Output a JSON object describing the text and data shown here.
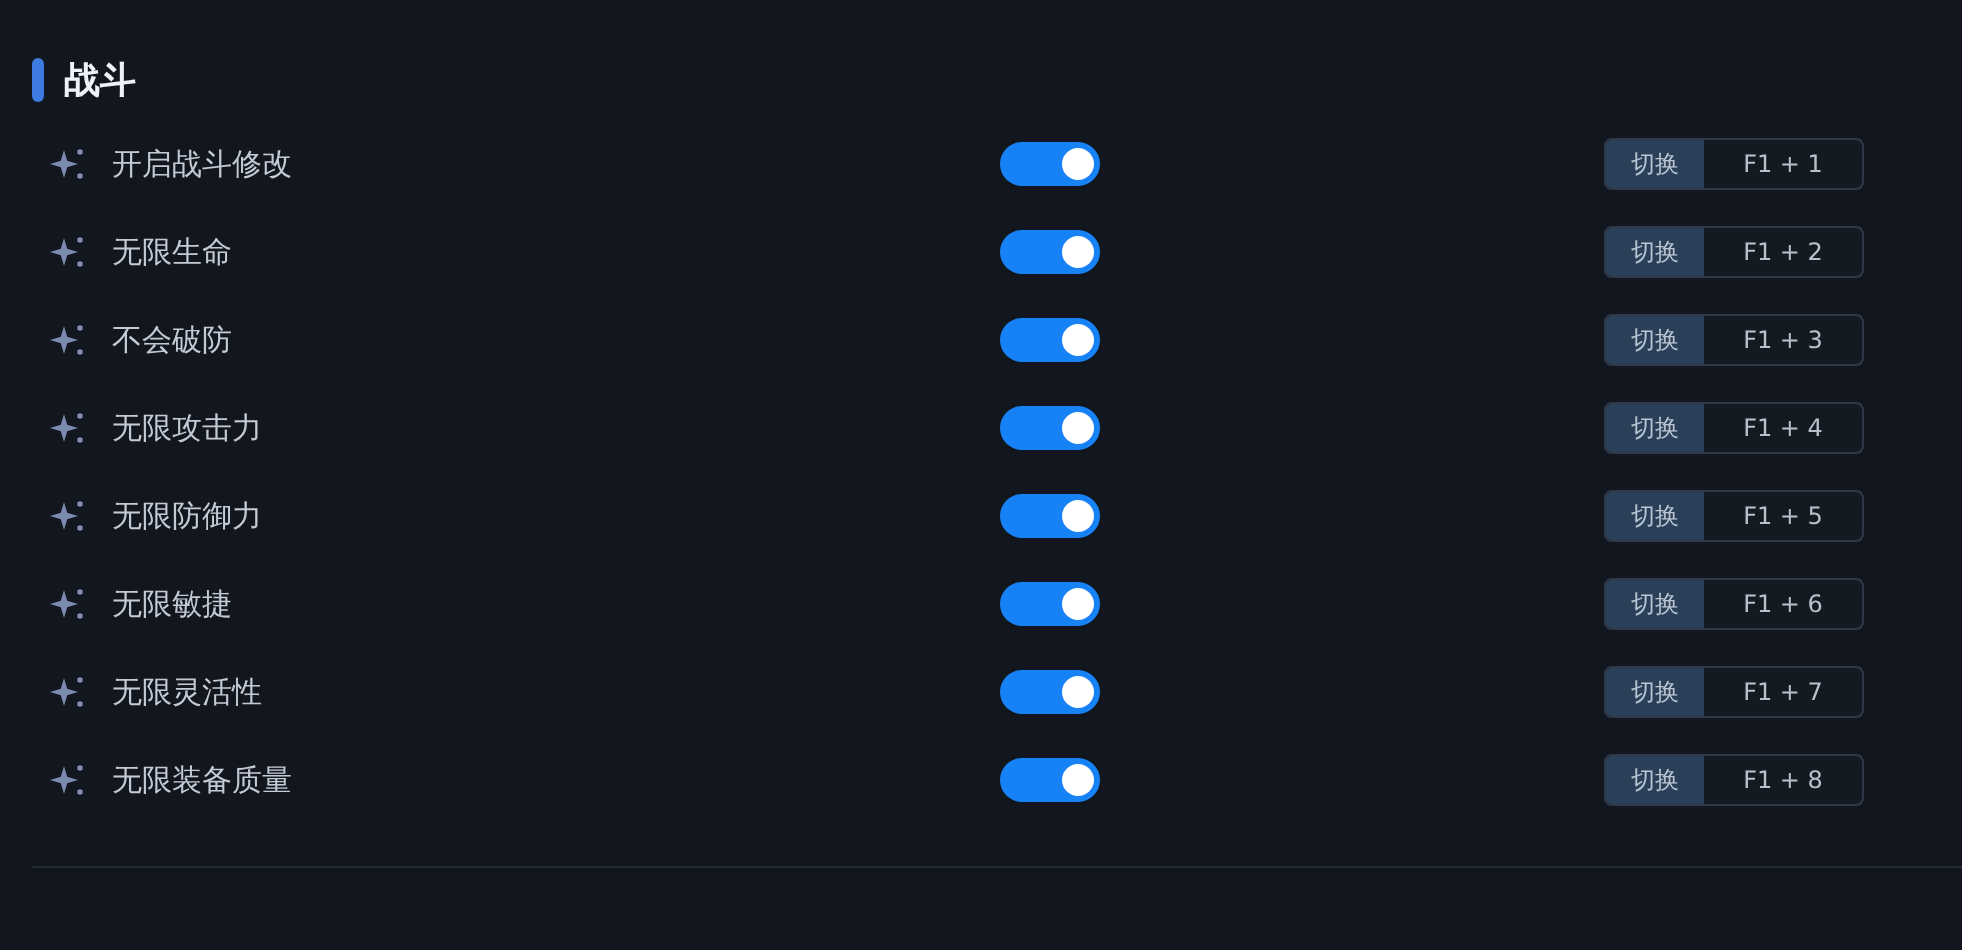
{
  "section": {
    "title": "战斗"
  },
  "rows": [
    {
      "label": "开启战斗修改",
      "on": true,
      "action": "切换",
      "hotkey": "F1 + 1"
    },
    {
      "label": "无限生命",
      "on": true,
      "action": "切换",
      "hotkey": "F1 + 2"
    },
    {
      "label": "不会破防",
      "on": true,
      "action": "切换",
      "hotkey": "F1 + 3"
    },
    {
      "label": "无限攻击力",
      "on": true,
      "action": "切换",
      "hotkey": "F1 + 4"
    },
    {
      "label": "无限防御力",
      "on": true,
      "action": "切换",
      "hotkey": "F1 + 5"
    },
    {
      "label": "无限敏捷",
      "on": true,
      "action": "切换",
      "hotkey": "F1 + 6"
    },
    {
      "label": "无限灵活性",
      "on": true,
      "action": "切换",
      "hotkey": "F1 + 7"
    },
    {
      "label": "无限装备质量",
      "on": true,
      "action": "切换",
      "hotkey": "F1 + 8"
    }
  ]
}
